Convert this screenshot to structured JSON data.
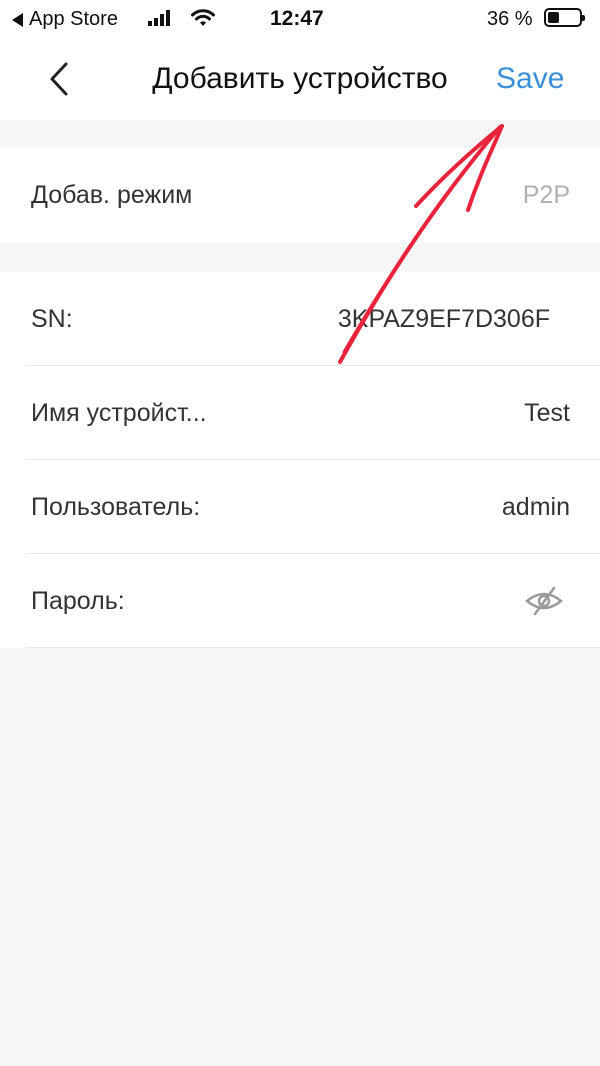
{
  "status_bar": {
    "back_app": "App Store",
    "time": "12:47",
    "battery_percent": "36 %"
  },
  "nav": {
    "title": "Добавить устройство",
    "save_label": "Save"
  },
  "form": {
    "mode": {
      "label": "Добав. режим",
      "value": "P2P"
    },
    "sn": {
      "label": "SN:",
      "value": "3KPAZ9EF7D306F"
    },
    "device_name": {
      "label": "Имя устройст...",
      "value": "Test"
    },
    "user": {
      "label": "Пользователь:",
      "value": "admin"
    },
    "password": {
      "label": "Пароль:",
      "toggle_icon": "eye-slash-icon"
    }
  },
  "colors": {
    "accent": "#3a8fd6",
    "annotation": "#e8243c",
    "background": "#f7f7f7"
  }
}
